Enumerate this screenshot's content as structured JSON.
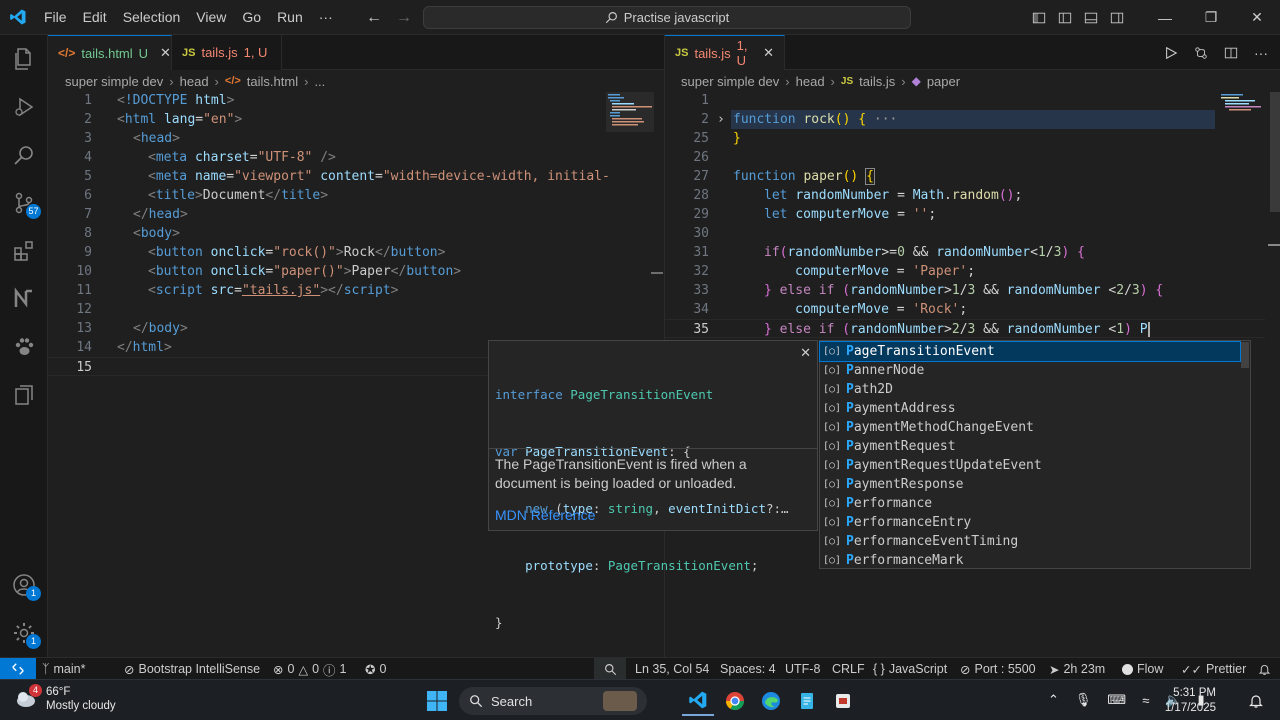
{
  "titlebar": {
    "menu": [
      "File",
      "Edit",
      "Selection",
      "View",
      "Go",
      "Run",
      "···"
    ],
    "command_center": "Practise javascript"
  },
  "activity": {
    "source_control_badge": "57",
    "accounts_badge": "1",
    "settings_badge": "1"
  },
  "left_editor": {
    "tab_active": {
      "name": "tails.html",
      "status": "U"
    },
    "tab_other": {
      "name": "tails.js",
      "status": "1, U"
    },
    "breadcrumb": [
      "super simple dev",
      "head",
      "tails.html",
      "..."
    ],
    "line_numbers": [
      "1",
      "2",
      "3",
      "4",
      "5",
      "6",
      "7",
      "8",
      "9",
      "10",
      "11",
      "12",
      "13",
      "14",
      "15"
    ],
    "current_line": "15"
  },
  "right_editor": {
    "tab_active": {
      "name": "tails.js",
      "status": "1, U"
    },
    "breadcrumb": [
      "super simple dev",
      "head",
      "tails.js",
      "paper"
    ],
    "line_numbers": [
      "1",
      "2",
      "25",
      "26",
      "27",
      "28",
      "29",
      "30",
      "31",
      "32",
      "33",
      "34",
      "35"
    ],
    "current_line": "35",
    "folded_ellipsis": "···"
  },
  "hover": {
    "signature_lines": [
      "interface PageTransitionEvent",
      "var PageTransitionEvent: {",
      "    new (type: string, eventInitDict?:…",
      "    prototype: PageTransitionEvent;",
      "}"
    ],
    "description": "The PageTransitionEvent is fired when a document is being loaded or unloaded.",
    "link": "MDN Reference"
  },
  "suggestions": [
    "PageTransitionEvent",
    "PannerNode",
    "Path2D",
    "PaymentAddress",
    "PaymentMethodChangeEvent",
    "PaymentRequest",
    "PaymentRequestUpdateEvent",
    "PaymentResponse",
    "Performance",
    "PerformanceEntry",
    "PerformanceEventTiming",
    "PerformanceMark"
  ],
  "statusbar": {
    "branch": "main*",
    "extension": "Bootstrap IntelliSense",
    "errors": "0",
    "warnings": "0",
    "info": "1",
    "ports": "0",
    "cursor": "Ln 35, Col 54",
    "spaces": "Spaces: 4",
    "encoding": "UTF-8",
    "eol": "CRLF",
    "language": "JavaScript",
    "port": "Port : 5500",
    "time": "2h 23m",
    "flow": "Flow",
    "prettier": "Prettier"
  },
  "taskbar": {
    "temp": "66°F",
    "weather": "Mostly cloudy",
    "weather_badge": "4",
    "search": "Search",
    "time": "5:31 PM",
    "date": "1/17/2025"
  },
  "colors": {
    "accent": "#0078d4",
    "editor_bg": "#1f1f1f",
    "selection_bg": "#04395e"
  }
}
